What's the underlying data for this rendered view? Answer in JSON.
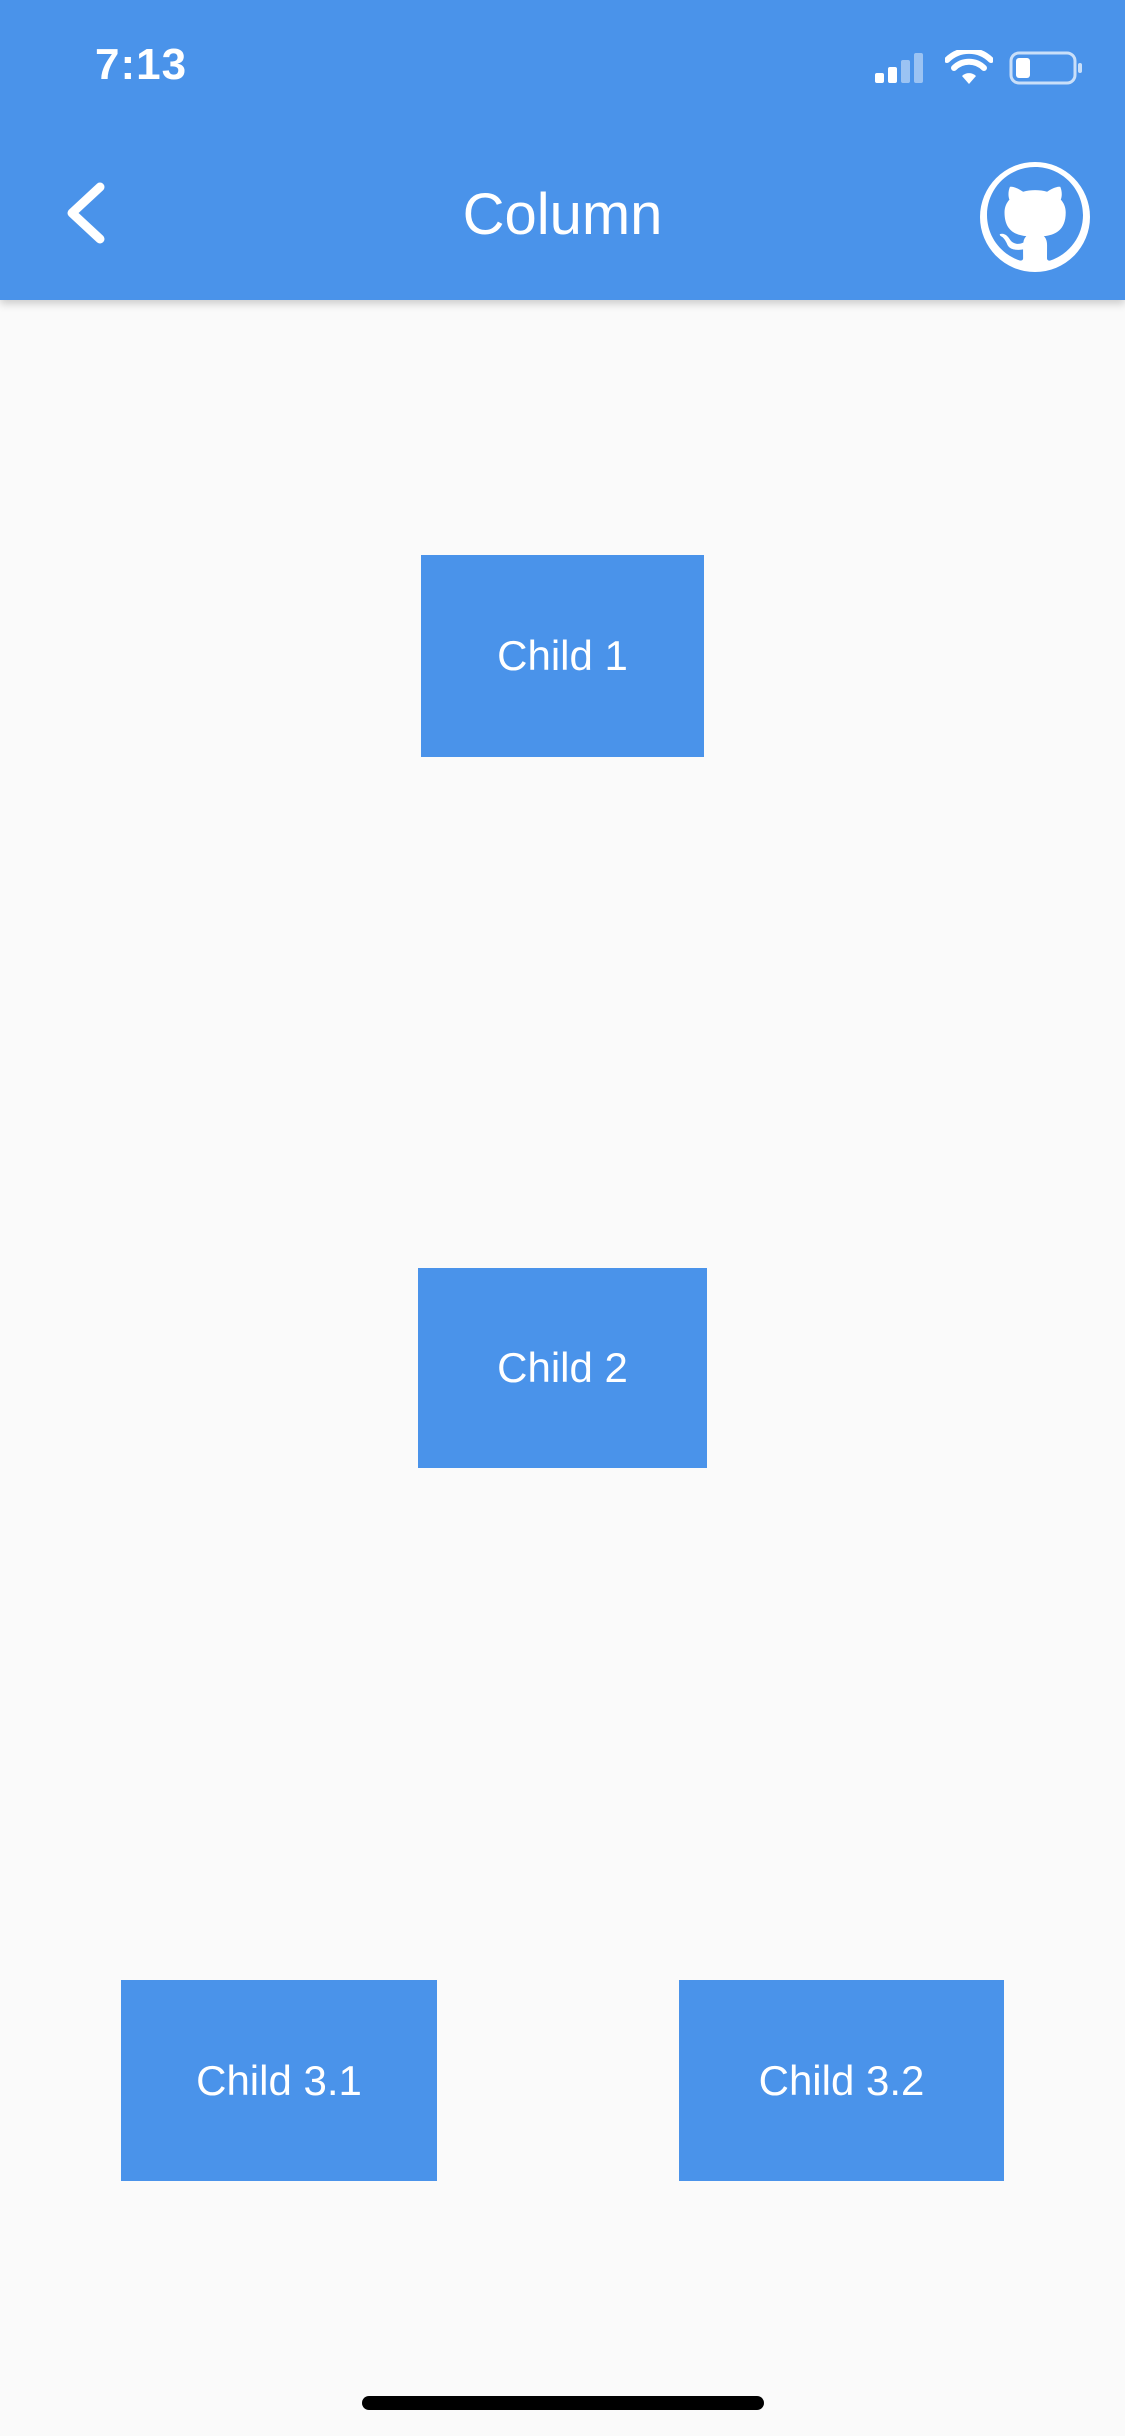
{
  "status_bar": {
    "time": "7:13",
    "icons": [
      "cellular-signal-icon",
      "wifi-icon",
      "battery-icon"
    ]
  },
  "app_bar": {
    "title": "Column",
    "back_icon": "chevron-left-icon",
    "action_icon": "github-icon",
    "color": "#4a93ea"
  },
  "children": {
    "child1": "Child 1",
    "child2": "Child 2",
    "child3_1": "Child 3.1",
    "child3_2": "Child 3.2"
  },
  "colors": {
    "primary": "#4a93ea",
    "background": "#fafafa",
    "on_primary": "#ffffff"
  }
}
